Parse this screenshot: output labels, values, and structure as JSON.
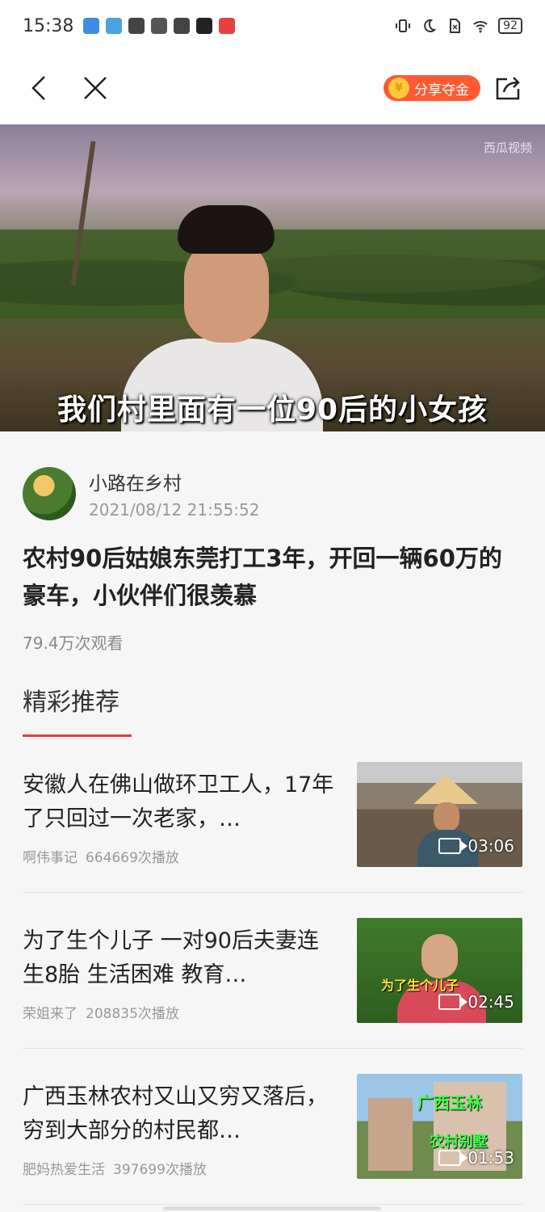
{
  "status_bar": {
    "time": "15:38",
    "battery": "92",
    "icons": [
      "vibrate-icon",
      "moon-icon",
      "no-sim-icon",
      "wifi-icon",
      "battery-icon"
    ]
  },
  "nav": {
    "share_gold_label": "分享夺金",
    "coin_glyph": "¥"
  },
  "video": {
    "watermark": "西瓜视频",
    "subtitle": "我们村里面有一位90后的小女孩"
  },
  "article": {
    "author_name": "小路在乡村",
    "publish_time": "2021/08/12 21:55:52",
    "title": "农村90后姑娘东莞打工3年，开回一辆60万的豪车，小伙伴们很羡慕",
    "views": "79.4万次观看"
  },
  "recommend": {
    "section_title": "精彩推荐",
    "items": [
      {
        "title": "安徽人在佛山做环卫工人，17年了只回过一次老家，…",
        "author": "啊伟事记",
        "plays": "664669次播放",
        "duration": "03:06"
      },
      {
        "title": "为了生个儿子 一对90后夫妻连生8胎 生活困难 教育…",
        "author": "荣姐来了",
        "plays": "208835次播放",
        "duration": "02:45",
        "thumb_caption": "为了生个儿子"
      },
      {
        "title": "广西玉林农村又山又穷又落后，穷到大部分的村民都…",
        "author": "肥妈热爱生活",
        "plays": "397699次播放",
        "duration": "01:53",
        "thumb_caption_1": "广西玉林",
        "thumb_caption_2": "农村别墅"
      }
    ]
  },
  "colors": {
    "accent": "#e53a3a",
    "share_gold_bg": "#ff5a32"
  }
}
